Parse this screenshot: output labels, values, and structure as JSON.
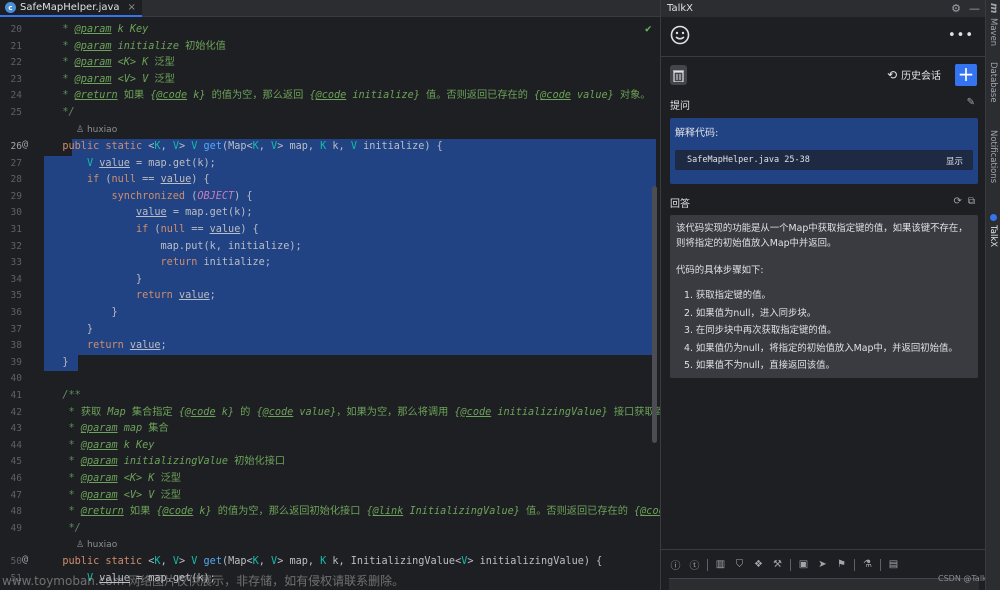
{
  "editor": {
    "tab": {
      "filename": "SafeMapHelper.java",
      "icon": "c",
      "close": "×"
    },
    "author1": "huxiao",
    "author2": "huxiao",
    "override_mark": "@"
  },
  "line_numbers": [
    "20",
    "21",
    "22",
    "23",
    "24",
    "25",
    "26",
    "27",
    "28",
    "29",
    "30",
    "31",
    "32",
    "33",
    "34",
    "35",
    "36",
    "37",
    "38",
    "39",
    "40",
    "41",
    "42",
    "43",
    "44",
    "45",
    "46",
    "47",
    "48",
    "49",
    "50",
    "51"
  ],
  "panel": {
    "title": "TalkX",
    "history_label": "历史会话",
    "ask_label": "提问",
    "ask_title": "解释代码:",
    "ref_file": "SafeMapHelper.java 25-38",
    "ref_show": "显示",
    "answer_label": "回答",
    "answer_intro": "该代码实现的功能是从一个Map中获取指定键的值，如果该键不存在，则将指定的初始值放入Map中并返回。",
    "answer_steps_title": "代码的具体步骤如下:",
    "answer_steps": [
      "1. 获取指定键的值。",
      "2. 如果值为null，进入同步块。",
      "3. 在同步块中再次获取指定键的值。",
      "4. 如果值仍为null，将指定的初始值放入Map中，并返回初始值。",
      "5. 如果值不为null，直接返回该值。"
    ],
    "credit": "CSDN @TalkX"
  },
  "strip": {
    "m": "m",
    "maven": "Maven",
    "database": "Database",
    "notifications": "Notifications",
    "talkx": "TalkX"
  },
  "watermark": "www.toymoban.com 网络图片仅供展示，非存储，如有侵权请联系删除。",
  "colors": {
    "selection": "#214283",
    "accent": "#3574f0",
    "background": "#1e1f22"
  }
}
